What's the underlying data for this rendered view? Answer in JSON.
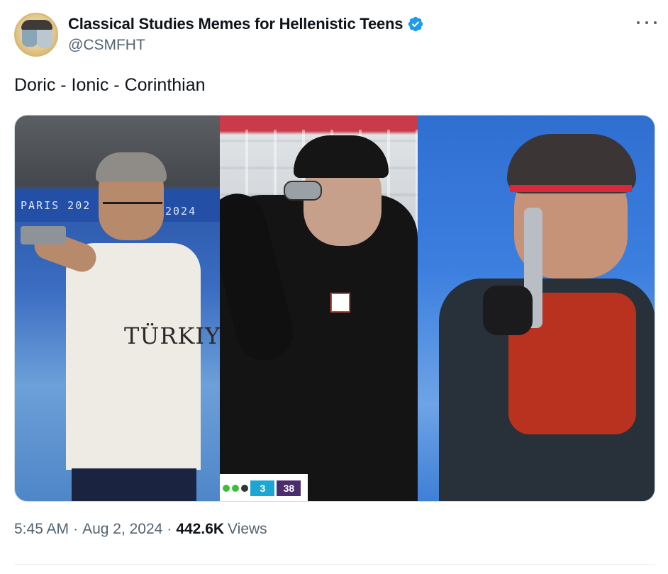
{
  "author": {
    "display_name": "Classical Studies Memes for Hellenistic Teens",
    "handle": "@CSMFHT",
    "verified": true,
    "verified_color": "#1d9bf0"
  },
  "more_button": {
    "icon": "more-horizontal-icon"
  },
  "tweet": {
    "text": "Doric - Ionic - Corinthian"
  },
  "media": {
    "panel1": {
      "banner_left": "PARIS 202",
      "banner_right": "2024",
      "shirt_text": "TÜRKIYE"
    },
    "panel2": {
      "score_label_a": "3",
      "score_label_b": "38",
      "score_color_a": "#1ba6d4",
      "score_color_b": "#4a2c6f"
    }
  },
  "footer": {
    "time": "5:45 AM",
    "date": "Aug 2, 2024",
    "separator": "·",
    "views_count": "442.6K",
    "views_label": "Views"
  }
}
